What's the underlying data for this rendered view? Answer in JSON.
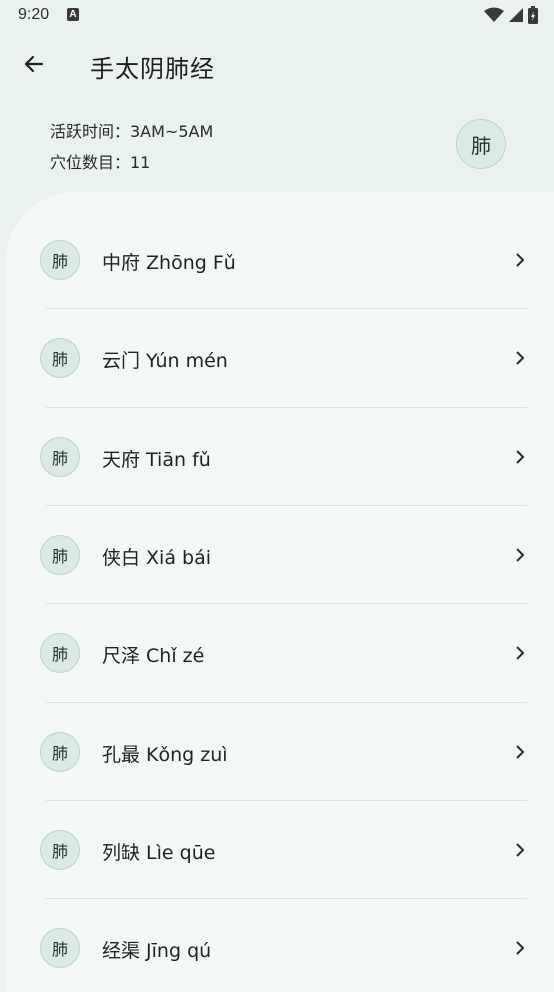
{
  "status": {
    "time": "9:20",
    "notif_letter": "A"
  },
  "header": {
    "title": "手太阴肺经",
    "back_icon": "arrow-left-icon"
  },
  "meridian": {
    "active_time": "活跃时间：3AM~5AM",
    "point_count": "穴位数目：11",
    "avatar_char": "肺"
  },
  "acupoints": [
    {
      "char": "肺",
      "label": "中府 Zhōng Fǔ"
    },
    {
      "char": "肺",
      "label": "云门 Yún mén"
    },
    {
      "char": "肺",
      "label": "天府 Tiān fǔ"
    },
    {
      "char": "肺",
      "label": "侠白 Xiá bái"
    },
    {
      "char": "肺",
      "label": "尺泽 Chǐ zé"
    },
    {
      "char": "肺",
      "label": "孔最 Kǒng zuì"
    },
    {
      "char": "肺",
      "label": "列缺 Lìe qūe"
    },
    {
      "char": "肺",
      "label": "经渠 Jīng qú"
    }
  ],
  "colors": {
    "background": "#e9f2f1",
    "card": "#f3f8f7",
    "avatar_bg": "#dbeae7",
    "avatar_border": "#b9d3ce"
  }
}
